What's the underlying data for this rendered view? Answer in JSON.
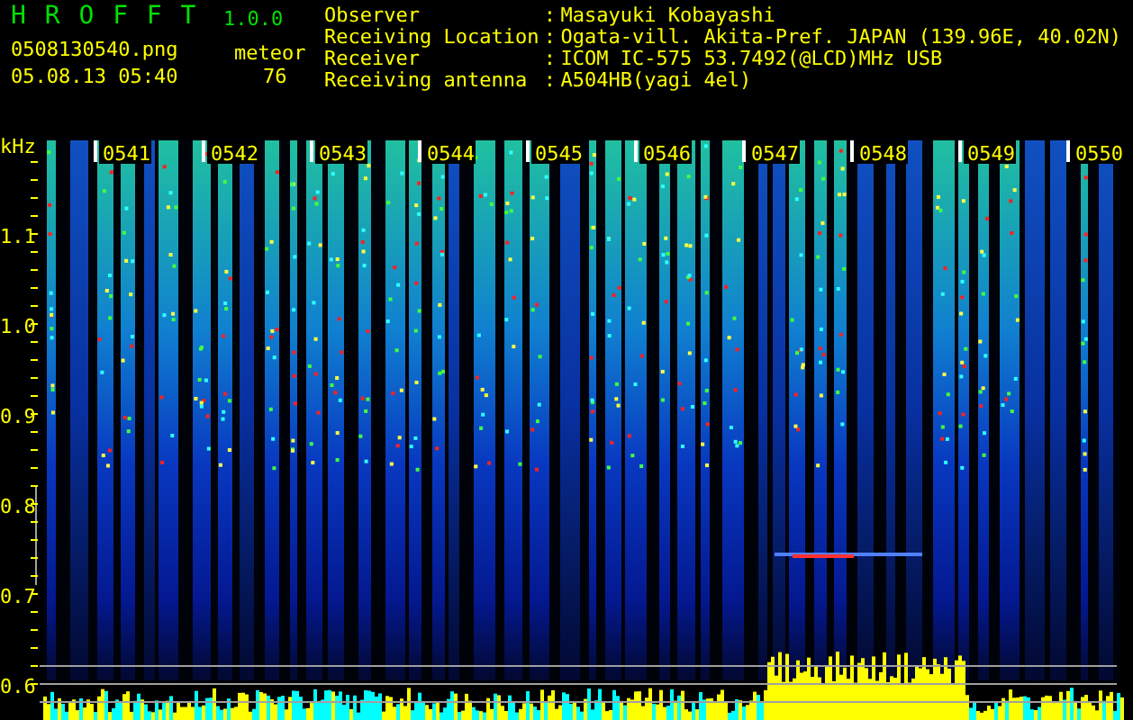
{
  "app": {
    "name": "H R O F F T",
    "version": "1.0.0",
    "file_name": "0508130540.png",
    "date_time": "05.08.13 05:40",
    "count_label": "meteor",
    "count": "76"
  },
  "station_info": [
    {
      "label": "Observer",
      "separator": ":",
      "value": "Masayuki Kobayashi"
    },
    {
      "label": "Receiving Location",
      "separator": ":",
      "value": "Ogata-vill. Akita-Pref. JAPAN (139.96E, 40.02N)"
    },
    {
      "label": "Receiver",
      "separator": ":",
      "value": "ICOM IC-575 53.7492(@LCD)MHz USB"
    },
    {
      "label": "Receiving antenna",
      "separator": ":",
      "value": "A504HB(yagi 4el)"
    }
  ],
  "spectrogram": {
    "unit": "kHz",
    "frequency_labels": [
      "1.1",
      "1.0",
      "0.9",
      "0.8",
      "0.7",
      "0.6"
    ],
    "time_labels": [
      "0541",
      "0542",
      "0543",
      "0544",
      "0545",
      "0546",
      "0547",
      "0548",
      "0549",
      "0550"
    ]
  }
}
